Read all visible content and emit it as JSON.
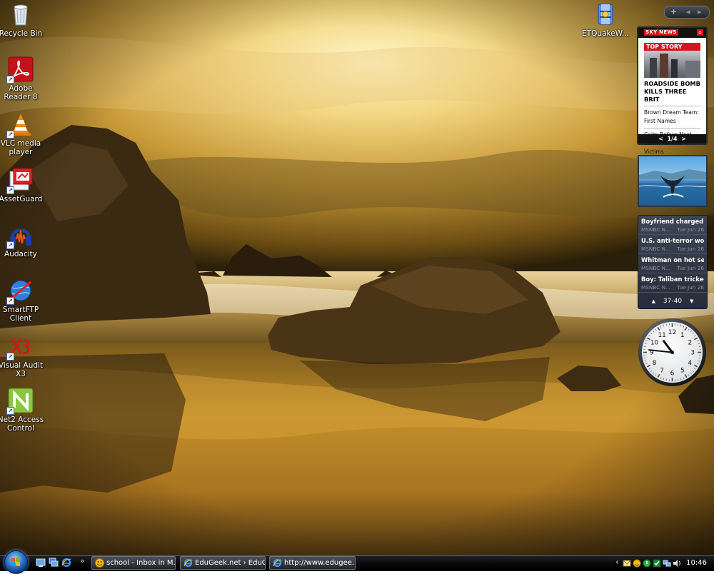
{
  "desktop": {
    "icons": [
      {
        "label": "Recycle Bin"
      },
      {
        "label": "Adobe\nReader 8"
      },
      {
        "label": "VLC media\nplayer"
      },
      {
        "label": "AssetGuard"
      },
      {
        "label": "Audacity"
      },
      {
        "label": "SmartFTP\nClient"
      },
      {
        "label": "Visual Audit\nX3"
      },
      {
        "label": "Net2 Access\nControl"
      },
      {
        "label": "ETQuakeW..."
      }
    ]
  },
  "sidebar": {
    "controls": {
      "add": "+",
      "prev": "◂",
      "next": "▸"
    },
    "skynews": {
      "brand": "SKY NEWS",
      "section": "TOP STORY",
      "headline": "ROADSIDE BOMB KILLS THREE BRIT",
      "items": [
        "Brown Dream Team: First Names",
        "Calm Before Next Storm As New Victims"
      ],
      "page": "1/4",
      "prev": "<",
      "next": ">"
    },
    "feed": {
      "items": [
        {
          "title": "Boyfriend charged in...",
          "source": "MSNBC N...",
          "date": "Tue Jun 26"
        },
        {
          "title": "U.S. anti-terror work...",
          "source": "MSNBC N...",
          "date": "Tue Jun 26"
        },
        {
          "title": "Whitman on hot seat...",
          "source": "MSNBC N...",
          "date": "Tue Jun 26"
        },
        {
          "title": "Boy: Taliban tricked ...",
          "source": "MSNBC N...",
          "date": "Tue Jun 26"
        }
      ],
      "range": "37-40",
      "up": "▲",
      "down": "▼"
    },
    "clock": {
      "hour": 10,
      "minute": 46,
      "numerals": [
        "12",
        "1",
        "2",
        "3",
        "4",
        "5",
        "6",
        "7",
        "8",
        "9",
        "10",
        "11"
      ]
    }
  },
  "taskbar": {
    "overflow": "»",
    "buttons": [
      {
        "label": "school - Inbox in M..."
      },
      {
        "label": "EduGeek.net › EduG..."
      },
      {
        "label": "http://www.edugee..."
      }
    ],
    "tray_expand": "‹",
    "time": "10:46"
  },
  "colors": {
    "sky_red": "#d6121a",
    "taskbar": "#060708",
    "accent_blue": "#2a6fc4"
  }
}
